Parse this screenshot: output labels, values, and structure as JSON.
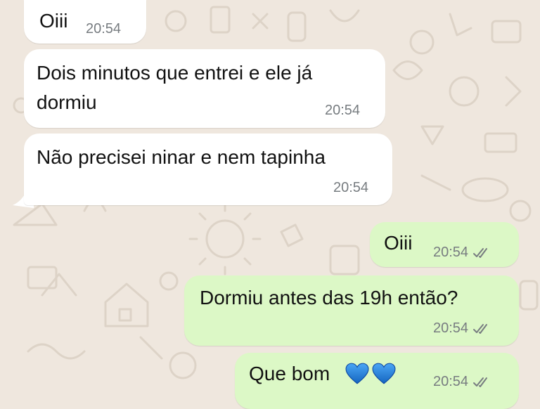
{
  "theme": {
    "background": "#efe7de",
    "incoming_bubble": "#ffffff",
    "outgoing_bubble": "#dcf8c6",
    "read_ticks": "#777c80",
    "heart_color": "#1e88e5"
  },
  "messages": [
    {
      "direction": "incoming",
      "text": "Oiii",
      "time": "20:54"
    },
    {
      "direction": "incoming",
      "lines": [
        "Dois minutos que entrei e ele já",
        "dormiu"
      ],
      "time": "20:54"
    },
    {
      "direction": "incoming",
      "text": "Não precisei ninar e nem tapinha",
      "time": "20:54"
    },
    {
      "direction": "outgoing",
      "text": "Oiii",
      "time": "20:54",
      "status_icon": "double-check-icon"
    },
    {
      "direction": "outgoing",
      "text": "Dormiu antes das 19h então?",
      "time": "20:54",
      "status_icon": "double-check-icon"
    },
    {
      "direction": "outgoing",
      "text": "Que bom",
      "emoji": [
        "blue-heart-icon",
        "blue-heart-icon"
      ],
      "time": "20:54",
      "status_icon": "double-check-icon"
    }
  ]
}
